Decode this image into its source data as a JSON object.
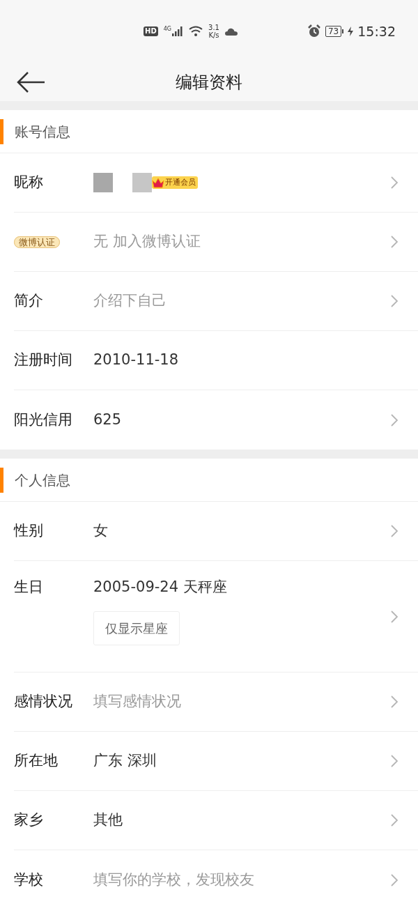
{
  "status_bar": {
    "hd": "HD",
    "network": "4G",
    "speed_value": "3.1",
    "speed_unit": "K/s",
    "battery": "73",
    "time": "15:32"
  },
  "header": {
    "title": "编辑资料"
  },
  "sections": [
    {
      "title": "账号信息",
      "rows": [
        {
          "kind": "nickname",
          "label": "昵称",
          "badge": "开通会员",
          "chevron": true
        },
        {
          "kind": "badge-label",
          "label": "微博认证",
          "placeholder": "无 加入微博认证",
          "chevron": true
        },
        {
          "kind": "text",
          "label": "简介",
          "placeholder": "介绍下自己",
          "chevron": true
        },
        {
          "kind": "text",
          "label": "注册时间",
          "value": "2010-11-18",
          "chevron": false
        },
        {
          "kind": "text",
          "label": "阳光信用",
          "value": "625",
          "chevron": true
        }
      ]
    },
    {
      "title": "个人信息",
      "rows": [
        {
          "kind": "text",
          "label": "性别",
          "value": "女",
          "chevron": true
        },
        {
          "kind": "birthday",
          "label": "生日",
          "value": "2005-09-24 天秤座",
          "chevron": true,
          "option": "仅显示星座"
        },
        {
          "kind": "text",
          "label": "感情状况",
          "placeholder": "填写感情状况",
          "chevron": true
        },
        {
          "kind": "text",
          "label": "所在地",
          "value": "广东 深圳",
          "chevron": true
        },
        {
          "kind": "text",
          "label": "家乡",
          "value": "其他",
          "chevron": true
        },
        {
          "kind": "text",
          "label": "学校",
          "placeholder": "填写你的学校，发现校友",
          "chevron": true
        }
      ]
    }
  ]
}
